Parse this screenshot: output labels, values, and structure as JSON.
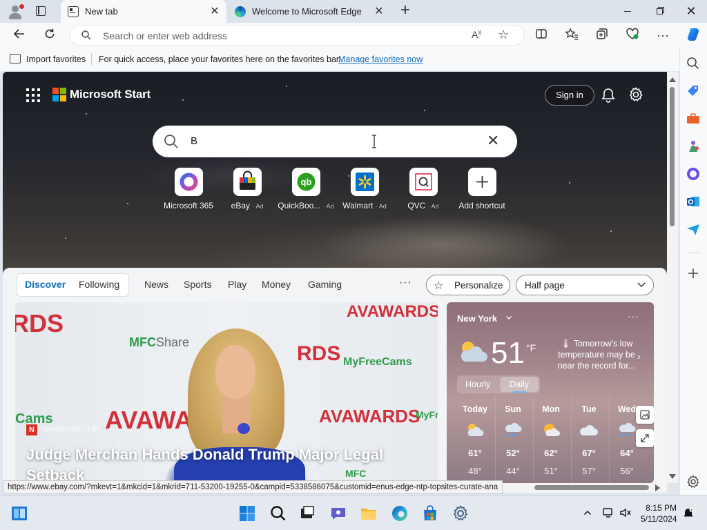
{
  "browser": {
    "tabs": [
      {
        "title": "New tab",
        "active": true,
        "favicon": "new-tab-icon"
      },
      {
        "title": "Welcome to Microsoft Edge",
        "active": false,
        "favicon": "edge-icon"
      }
    ],
    "address": {
      "placeholder": "Search or enter web address"
    },
    "favorites_bar": {
      "import_label": "Import favorites",
      "hint": "For quick access, place your favorites here on the favorites bar.",
      "manage_link": "Manage favorites now"
    },
    "status_url": "https://www.ebay.com/?mkevt=1&mkcid=1&mkrid=711-53200-19255-0&campid=5338586075&customid=enus-edge-ntp-topsites-curate-ana"
  },
  "ntp": {
    "brand": "Microsoft Start",
    "sign_in": "Sign in",
    "search_value": "B",
    "shortcuts": [
      {
        "label": "Microsoft 365",
        "ad": "",
        "icon": "microsoft-365-icon"
      },
      {
        "label": "eBay",
        "ad": "· Ad",
        "icon": "ebay-icon"
      },
      {
        "label": "QuickBoo...",
        "ad": "· Ad",
        "icon": "quickbooks-icon"
      },
      {
        "label": "Walmart",
        "ad": "· Ad",
        "icon": "walmart-icon"
      },
      {
        "label": "QVC",
        "ad": "· Ad",
        "icon": "qvc-icon"
      },
      {
        "label": "Add shortcut",
        "ad": "",
        "icon": "plus-icon"
      }
    ],
    "feed_nav": {
      "discover": "Discover",
      "following": "Following",
      "items": [
        "News",
        "Sports",
        "Play",
        "Money",
        "Gaming"
      ],
      "more": "···",
      "personalize": "Personalize",
      "layout": "Half page"
    },
    "news": {
      "source_badge": "N",
      "source": "Newsweek · 14h",
      "headline": "Judge Merchan Hands Donald Trump Major Legal Setback"
    },
    "weather": {
      "city": "New York",
      "temp": "51",
      "unit": "°F",
      "alert": "Tomorrow's low temperature may be near the record for...",
      "toggle_hourly": "Hourly",
      "toggle_daily": "Daily",
      "days": [
        {
          "name": "Today",
          "hi": "61°",
          "lo": "48°",
          "icon": "partly-cloudy-icon"
        },
        {
          "name": "Sun",
          "hi": "52°",
          "lo": "44°",
          "icon": "rain-icon"
        },
        {
          "name": "Mon",
          "hi": "62°",
          "lo": "51°",
          "icon": "partly-sunny-icon"
        },
        {
          "name": "Tue",
          "hi": "67°",
          "lo": "57°",
          "icon": "cloudy-icon"
        },
        {
          "name": "Wed",
          "hi": "64°",
          "lo": "56°",
          "icon": "rain-icon"
        }
      ]
    }
  },
  "taskbar": {
    "time": "8:15 PM",
    "date": "5/11/2024"
  },
  "colors": {
    "accent": "#0f6cbd",
    "taskbar": "#e4e9f0"
  }
}
